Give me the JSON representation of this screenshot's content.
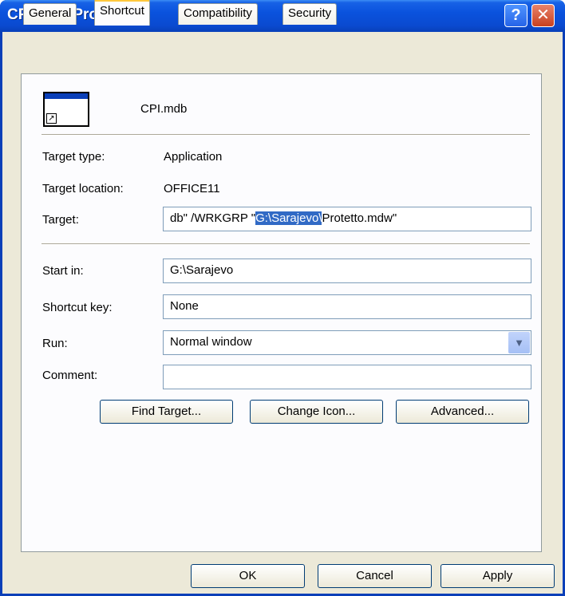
{
  "window": {
    "title": "CPI.mdb Properties",
    "help_glyph": "?",
    "close_glyph": "✕"
  },
  "tabs": [
    {
      "label": "General"
    },
    {
      "label": "Shortcut",
      "active": true
    },
    {
      "label": "Compatibility"
    },
    {
      "label": "Security"
    }
  ],
  "shortcut": {
    "file_name": "CPI.mdb",
    "target_type_label": "Target type:",
    "target_type_value": "Application",
    "target_location_label": "Target location:",
    "target_location_value": "OFFICE11",
    "target_label": "Target:",
    "target_value_pre": "db\" /WRKGRP \"",
    "target_value_selected": "G:\\Sarajevo\\",
    "target_value_post": "Protetto.mdw\"",
    "start_in_label": "Start in:",
    "start_in_value": "G:\\Sarajevo",
    "shortcut_key_label": "Shortcut key:",
    "shortcut_key_value": "None",
    "run_label": "Run:",
    "run_value": "Normal window",
    "comment_label": "Comment:",
    "comment_value": "",
    "find_target_label": "Find Target...",
    "change_icon_label": "Change Icon...",
    "advanced_label": "Advanced..."
  },
  "footer": {
    "ok_label": "OK",
    "cancel_label": "Cancel",
    "apply_label": "Apply"
  },
  "colors": {
    "title_bar": "#0a4ad0",
    "selection": "#316ac5",
    "active_tab_accent": "#ffc83c"
  },
  "icons": {
    "help": "help-icon",
    "close": "close-icon",
    "dropdown": "chevron-down-icon",
    "shortcut": "shortcut-arrow-icon"
  }
}
